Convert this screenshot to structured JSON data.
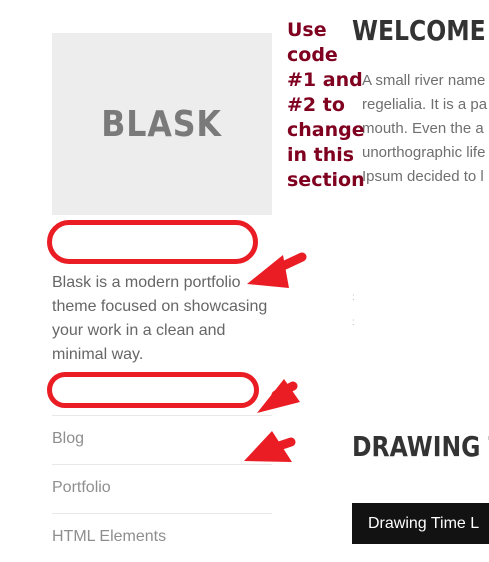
{
  "sidebar": {
    "logo_text": "BLASK",
    "tagline": "Blask is a modern portfolio theme focused on showcasing your work in a clean and minimal way.",
    "nav": [
      "Blog",
      "Portfolio",
      "HTML Elements"
    ]
  },
  "main": {
    "welcome_title": "WELCOME",
    "intro_lines": [
      "A small river name",
      "regelialia. It is a pa",
      "mouth. Even the a",
      "unorthographic life",
      "Ipsum decided to l"
    ],
    "drawing_title": "DRAWING T",
    "video_title": "Drawing Time L"
  },
  "annotation": {
    "note": "Use code #1 and #2 to change in this section",
    "color": "#800020",
    "marker_color": "#ea1c24"
  }
}
